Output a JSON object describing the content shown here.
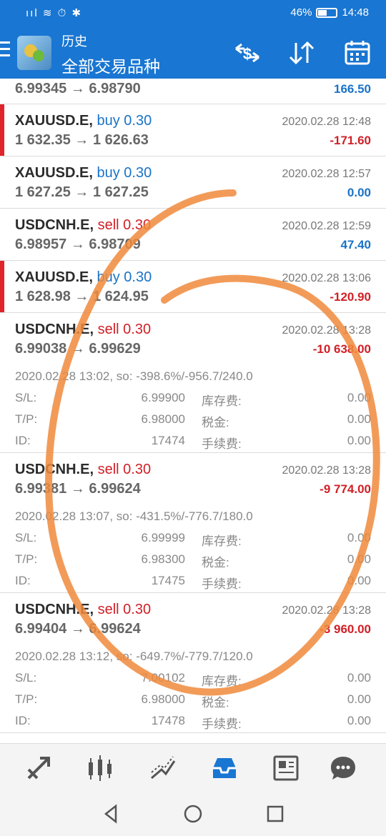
{
  "status_bar": {
    "signal": "ııl ≋ ⏱ ✱",
    "battery": "46%",
    "time": "14:48"
  },
  "header": {
    "title": "历史",
    "subtitle": "全部交易品种"
  },
  "icons": {
    "menu": "menu-icon",
    "currency": "currency-exchange-icon",
    "sort": "sort-icon",
    "calendar": "calendar-icon"
  },
  "trades": [
    {
      "symbol": "",
      "side": "",
      "volume": "",
      "prices": "6.99345 → 6.98790",
      "time": "",
      "profit": "166.50",
      "profit_color": "#1a73c8"
    },
    {
      "symbol": "XAUUSD.E,",
      "side": "buy 0.30",
      "prices": "1 632.35 → 1 626.63",
      "time": "2020.02.28 12:48",
      "profit": "-171.60"
    },
    {
      "symbol": "XAUUSD.E,",
      "side": "buy 0.30",
      "prices": "1 627.25 → 1 627.25",
      "time": "2020.02.28 12:57",
      "profit": "0.00"
    },
    {
      "symbol": "USDCNH.E,",
      "side": "sell 0.30",
      "prices": "6.98957 → 6.98709",
      "time": "2020.02.28 12:59",
      "profit": "47.40"
    },
    {
      "symbol": "XAUUSD.E,",
      "side": "buy 0.30",
      "prices": "1 628.98 → 1 624.95",
      "time": "2020.02.28 13:06",
      "profit": "-120.90"
    },
    {
      "symbol": "USDCNH.E,",
      "side": "sell 0.30",
      "prices": "6.99038 → 6.99629",
      "time": "2020.02.28 13:28",
      "profit": "-10 638.00",
      "detail": "2020.02.28 13:02, so: -398.6%/-956.7/240.0",
      "sl_label": "S/L:",
      "sl": "6.99900",
      "swap_label": "库存费:",
      "swap": "0.00",
      "tp_label": "T/P:",
      "tp": "6.98000",
      "tax_label": "税金:",
      "tax": "0.00",
      "id_label": "ID:",
      "id": "17474",
      "fee_label": "手续费:",
      "fee": "0.00"
    },
    {
      "symbol": "USDCNH.E,",
      "side": "sell 0.30",
      "prices": "6.99381 → 6.99624",
      "time": "2020.02.28 13:28",
      "profit": "-9 774.00",
      "detail": "2020.02.28 13:07, so: -431.5%/-776.7/180.0",
      "sl_label": "S/L:",
      "sl": "6.99999",
      "swap_label": "库存费:",
      "swap": "0.00",
      "tp_label": "T/P:",
      "tp": "6.98300",
      "tax_label": "税金:",
      "tax": "0.00",
      "id_label": "ID:",
      "id": "17475",
      "fee_label": "手续费:",
      "fee": "0.00"
    },
    {
      "symbol": "USDCNH.E,",
      "side": "sell 0.30",
      "prices": "6.99404 → 6.99624",
      "time": "2020.02.28 13:28",
      "profit": "-3 960.00",
      "detail": "2020.02.28 13:12, so: -649.7%/-779.7/120.0",
      "sl_label": "S/L:",
      "sl": "7.00102",
      "swap_label": "库存费:",
      "swap": "0.00",
      "tp_label": "T/P:",
      "tp": "6.98000",
      "tax_label": "税金:",
      "tax": "0.00",
      "id_label": "ID:",
      "id": "17478",
      "fee_label": "手续费:",
      "fee": "0.00"
    }
  ],
  "bottom_nav": [
    {
      "name": "quotes-icon"
    },
    {
      "name": "chart-icon"
    },
    {
      "name": "trade-icon"
    },
    {
      "name": "history-icon",
      "active": true
    },
    {
      "name": "news-icon"
    },
    {
      "name": "chat-icon"
    }
  ],
  "colors": {
    "header": "#1976d2",
    "positive": "#1a73c8",
    "negative": "#d02027",
    "annotation": "#f08a3c"
  }
}
